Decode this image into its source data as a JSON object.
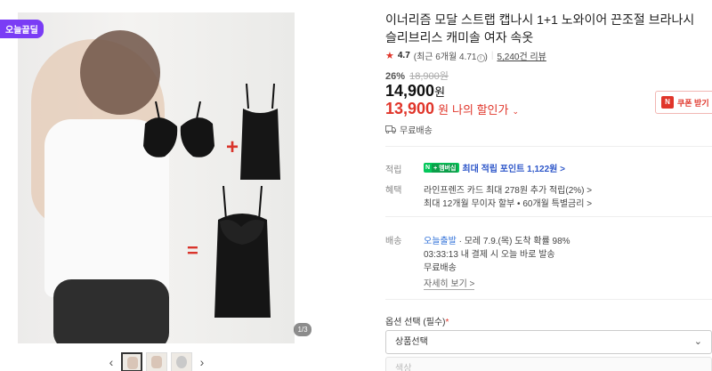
{
  "gallery": {
    "badge": "오늘끝딜",
    "counter": "1/3",
    "prev_icon": "chevron-left-icon",
    "next_icon": "chevron-right-icon",
    "thumb_count": 3
  },
  "product": {
    "title": "이너리즘 모달 스트랩 캡나시 1+1 노와이어 끈조절 브라나시 슬리브리스 캐미솔 여자 속옷",
    "rating": "4.7",
    "rating_detail": "(최근 6개월 4.71",
    "rating_detail_close": ")",
    "reviews": "5,240건 리뷰",
    "discount_rate": "26%",
    "original_price": "18,900원",
    "price": "14,900",
    "price_unit": "원",
    "my_price": "13,900",
    "my_price_unit": "원",
    "my_price_label": "나의 할인가",
    "coupon_label": "쿠폰 받기",
    "coupon_icon_text": "N",
    "shipping": "무료배송"
  },
  "benefits": {
    "points_label": "적립",
    "npay_label": "N",
    "npay_plus": "+ 멤버십",
    "points_value": "최대 적립 포인트 1,122원 >",
    "benefit_label": "혜택",
    "benefit_line1": "라인프렌즈 카드 최대 278원 추가 적립(2%) >",
    "benefit_line2": "최대 12개월 무이자 할부 • 60개월 특별금리 >"
  },
  "delivery": {
    "label": "배송",
    "today": "오늘출발",
    "arrival": " · 모레 7.9.(목) 도착 확률 98%",
    "countdown": "03:33:13  내 결제 시 오늘 바로 발송",
    "fee": "무료배송",
    "more": "자세히 보기 >"
  },
  "options": {
    "label": "옵션 선택",
    "required": "(필수)",
    "required_mark": "*",
    "select1": "상품선택",
    "select2": "색상"
  },
  "colors": {
    "accent_red": "#e0352a",
    "badge_purple": "#7a3cf5",
    "npay_green": "#03c75a",
    "link_blue": "#2d6fd8"
  }
}
